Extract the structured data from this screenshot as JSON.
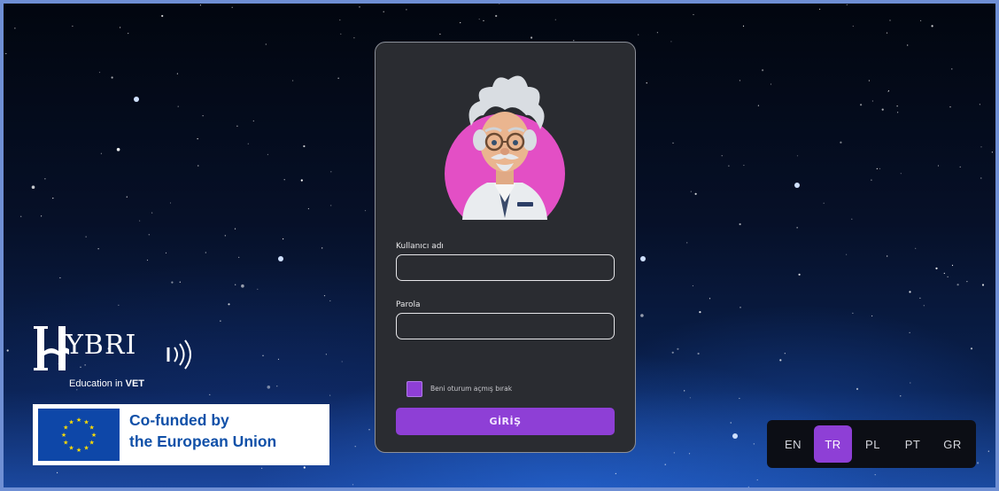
{
  "login": {
    "username_label": "Kullanıcı adı",
    "username_value": "",
    "password_label": "Parola",
    "password_value": "",
    "remember_label": "Beni oturum açmış bırak",
    "remember_checked": true,
    "submit_label": "GİRİŞ"
  },
  "branding": {
    "logo_text": "YBRI",
    "logo_sub_prefix": "Education in ",
    "logo_sub_bold": "VET",
    "eu_line1": "Co-funded by",
    "eu_line2": "the European Union"
  },
  "languages": {
    "items": [
      "EN",
      "TR",
      "PL",
      "PT",
      "GR"
    ],
    "selected": "TR"
  },
  "colors": {
    "accent": "#8e3fd6",
    "card_bg": "#2a2c31",
    "avatar_circle": "#e34fc5",
    "eu_blue": "#0e47a8",
    "eu_star": "#ffdd00"
  },
  "icons": [
    "sound-waves-icon",
    "book-icon",
    "eu-flag-icon",
    "scientist-avatar"
  ]
}
